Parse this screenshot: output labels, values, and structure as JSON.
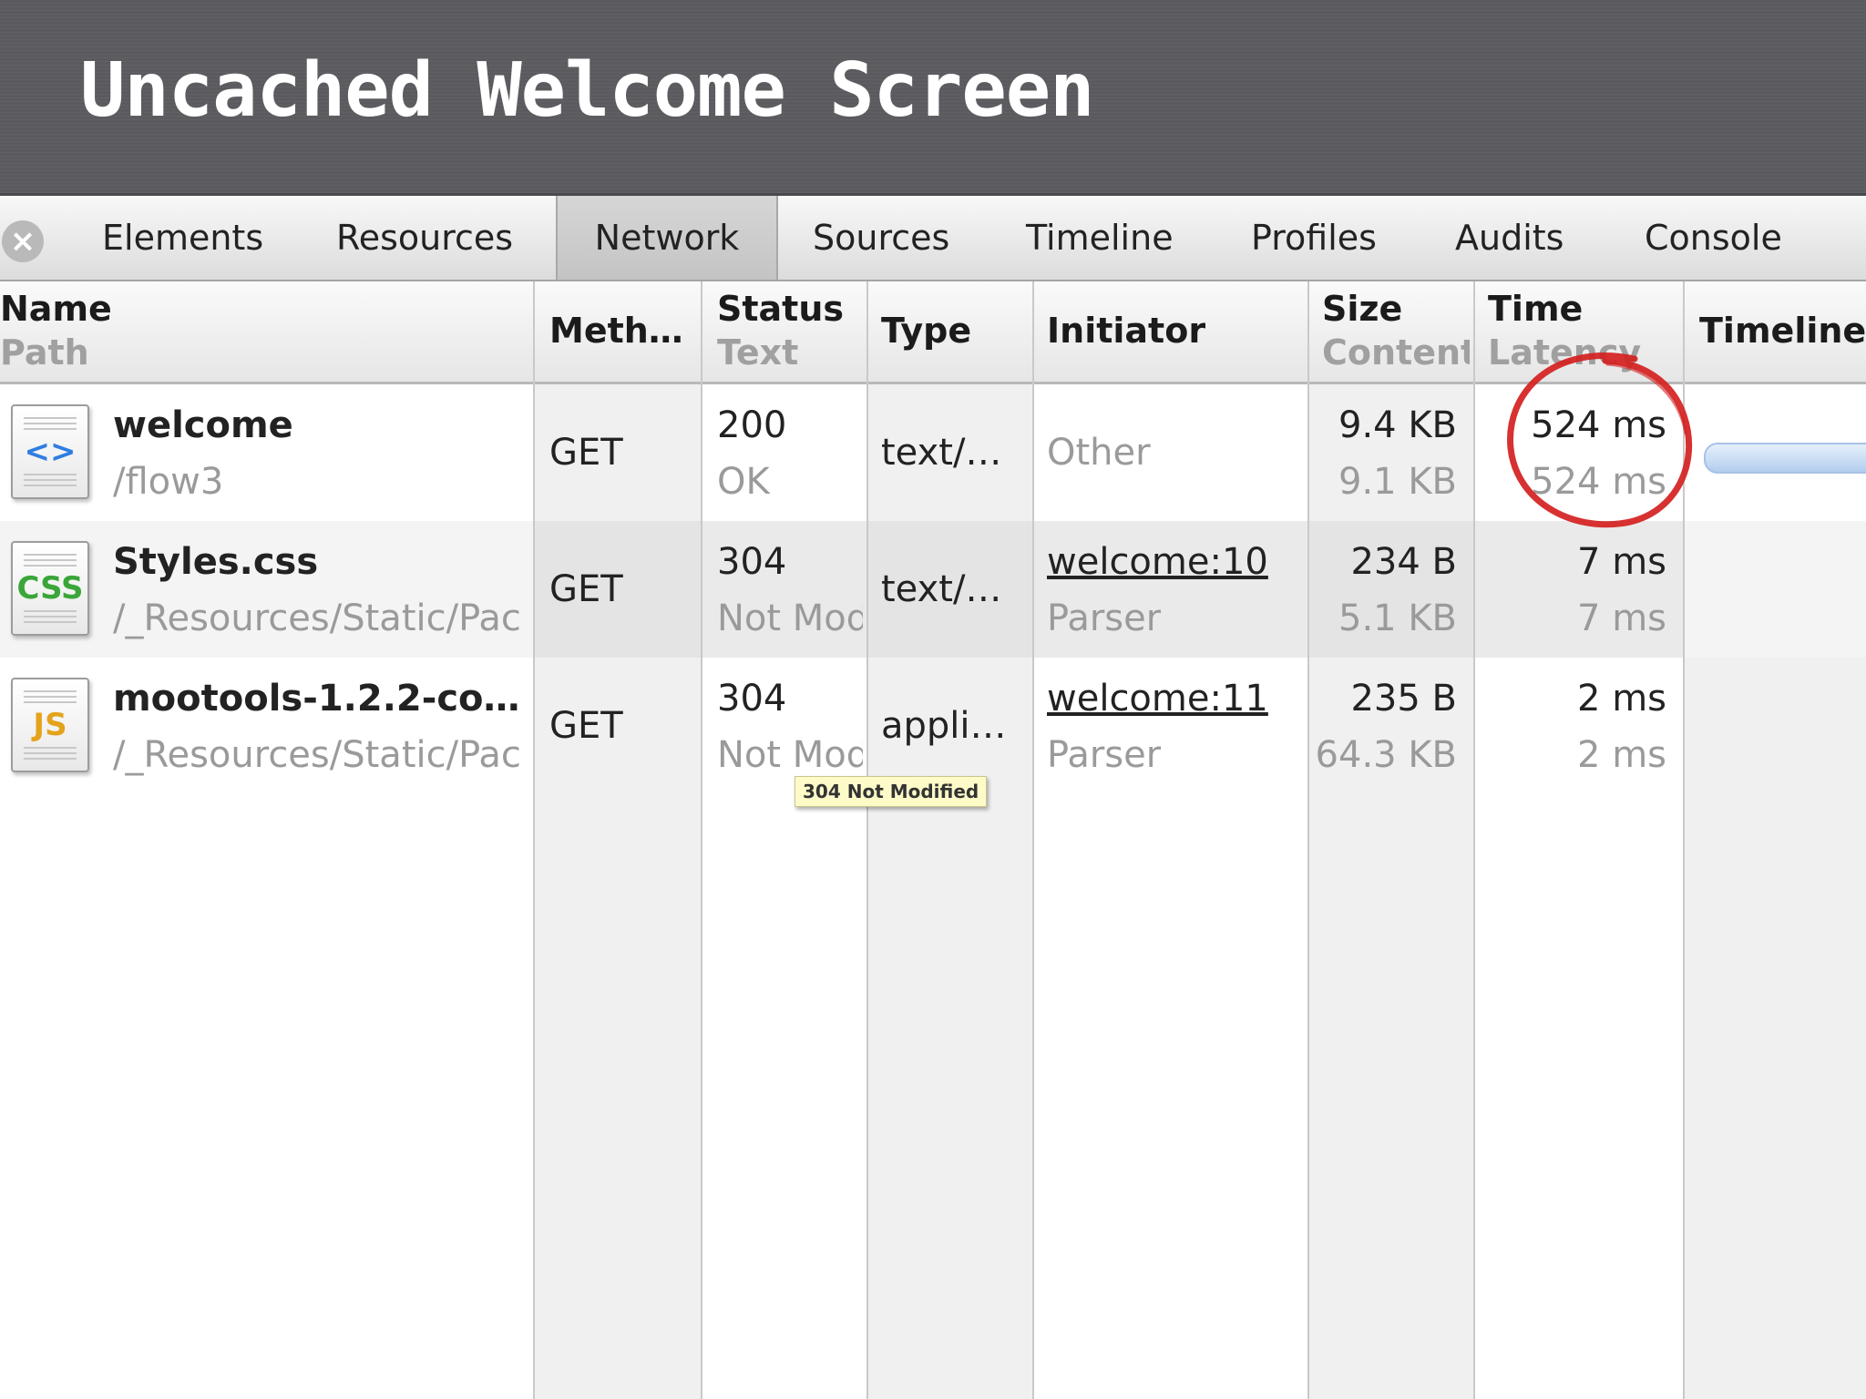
{
  "slide": {
    "title": "Uncached Welcome Screen"
  },
  "toolbar": {
    "close_icon": "close-icon",
    "tabs": [
      {
        "label": "Elements"
      },
      {
        "label": "Resources"
      },
      {
        "label": "Network",
        "active": true
      },
      {
        "label": "Sources"
      },
      {
        "label": "Timeline"
      },
      {
        "label": "Profiles"
      },
      {
        "label": "Audits"
      },
      {
        "label": "Console"
      }
    ]
  },
  "columns": {
    "name": {
      "main": "Name",
      "sub": "Path"
    },
    "method": {
      "main": "Meth…"
    },
    "status": {
      "main": "Status",
      "sub": "Text"
    },
    "type": {
      "main": "Type"
    },
    "initiator": {
      "main": "Initiator"
    },
    "size": {
      "main": "Size",
      "sub": "Content"
    },
    "time": {
      "main": "Time",
      "sub": "Latency"
    },
    "timeline": {
      "main": "Timeline"
    }
  },
  "rows": [
    {
      "icon": "html-file-icon",
      "icon_glyph": "<>",
      "icon_color": "#2f7de1",
      "name": "welcome",
      "path": "/flow3",
      "method": "GET",
      "status": "200",
      "status_text": "OK",
      "type": "text/…",
      "initiator": "Other",
      "initiator_sub": "",
      "size": "9.4 KB",
      "content": "9.1 KB",
      "time": "524 ms",
      "latency": "524 ms"
    },
    {
      "icon": "css-file-icon",
      "icon_glyph": "CSS",
      "icon_color": "#3aa63a",
      "name": "Styles.css",
      "path": "/_Resources/Static/Packages",
      "method": "GET",
      "status": "304",
      "status_text": "Not Modified",
      "type": "text/…",
      "initiator": "welcome:10",
      "initiator_sub": "Parser",
      "size": "234 B",
      "content": "5.1 KB",
      "time": "7 ms",
      "latency": "7 ms"
    },
    {
      "icon": "js-file-icon",
      "icon_glyph": "JS",
      "icon_color": "#e4a31c",
      "name": "mootools-1.2.2-co…",
      "path": "/_Resources/Static/Packages",
      "method": "GET",
      "status": "304",
      "status_text": "Not Modified",
      "type": "appli…",
      "initiator": "welcome:11",
      "initiator_sub": "Parser",
      "size": "235 B",
      "content": "64.3 KB",
      "time": "2 ms",
      "latency": "2 ms"
    }
  ],
  "tooltip": {
    "text": "304 Not Modified"
  },
  "colors": {
    "highlight_circle": "#d42020",
    "timeline_bar": "#b3cdee"
  }
}
